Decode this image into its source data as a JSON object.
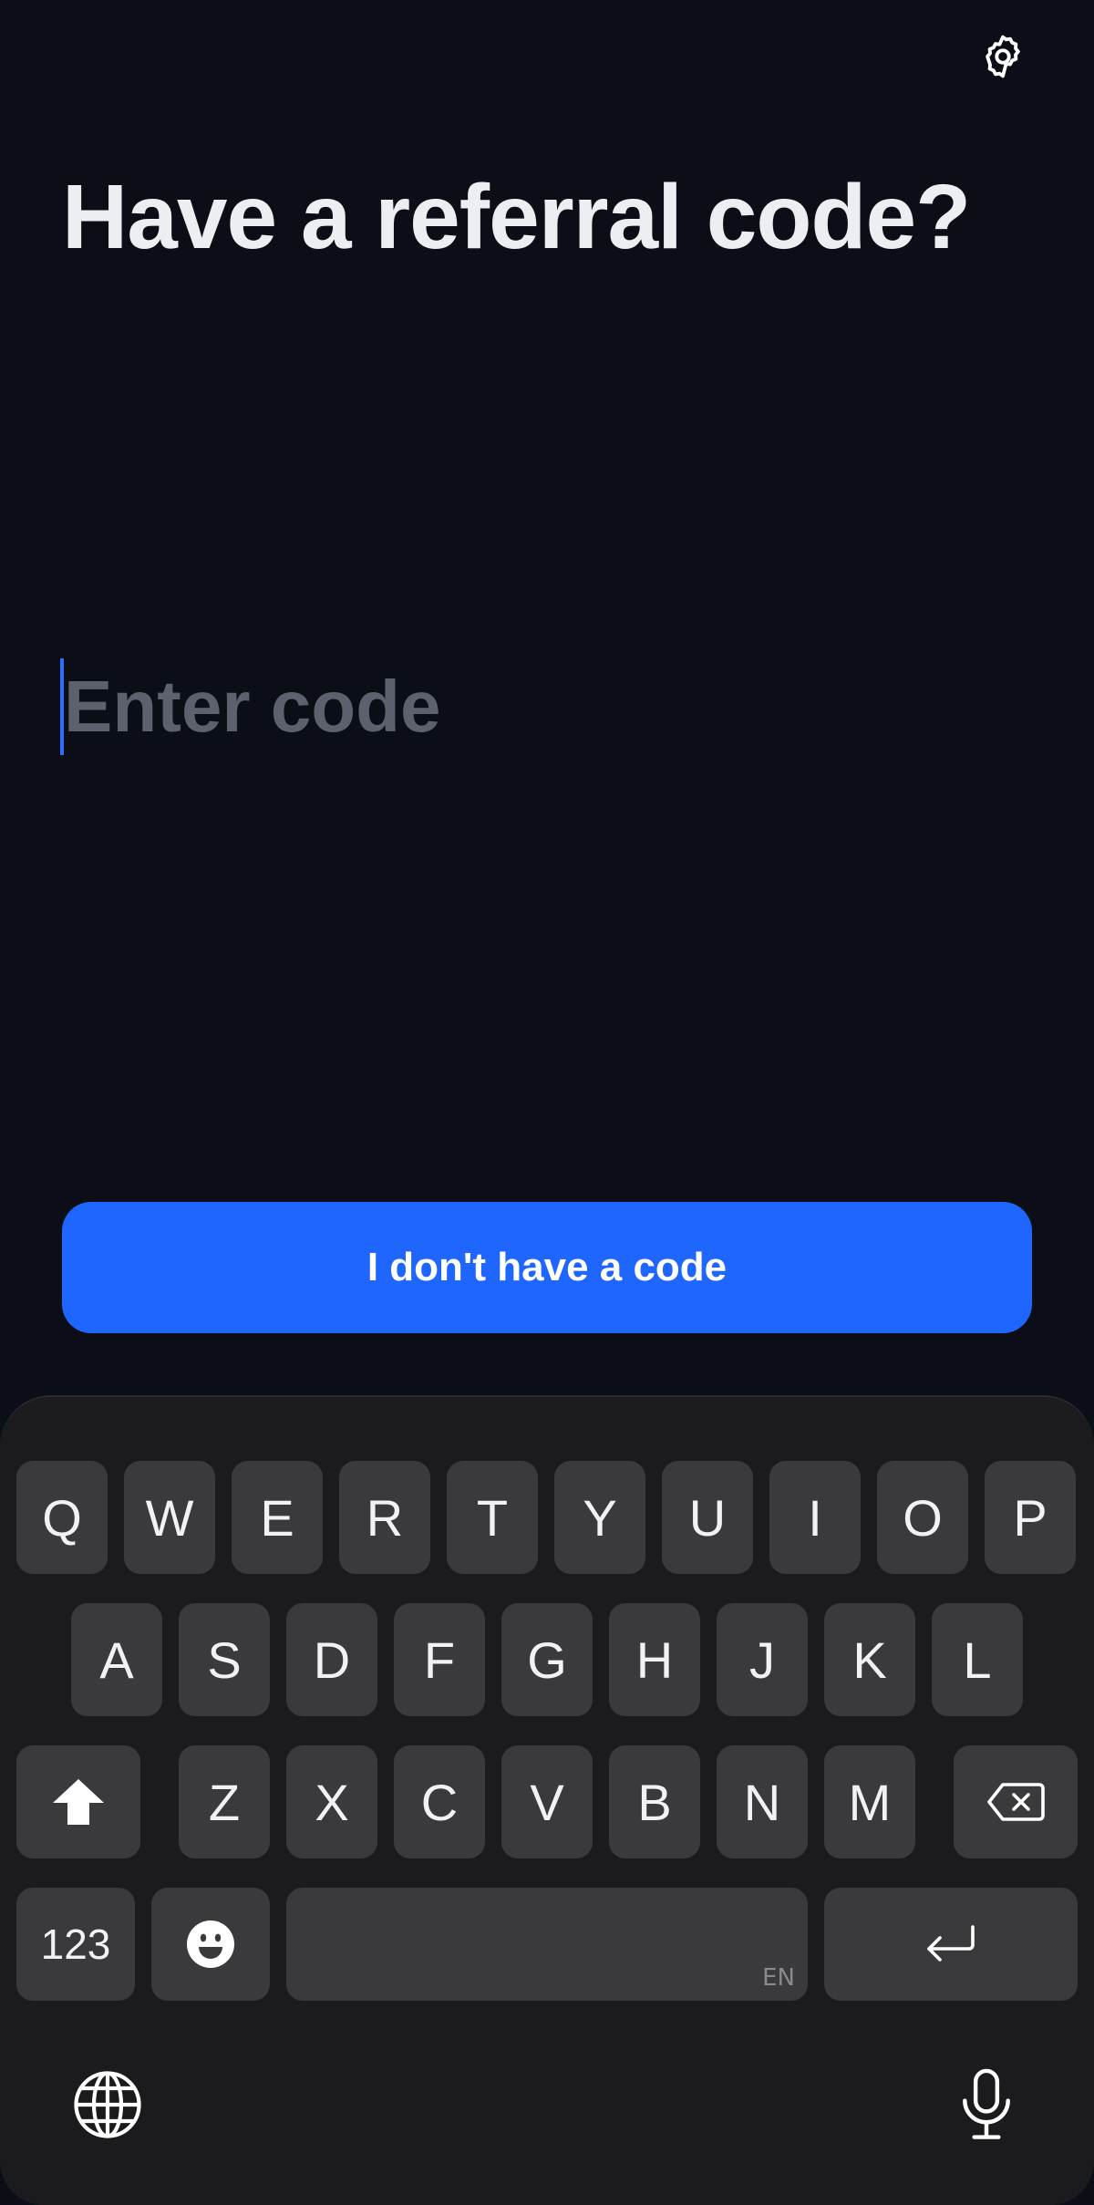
{
  "title": "Have a referral code?",
  "code_input": {
    "placeholder": "Enter code",
    "value": ""
  },
  "no_code_button": "I don't have a code",
  "colors": {
    "background": "#0b0e16",
    "accent": "#1f66ff",
    "keyboard_bg": "#1b1b1d",
    "key_bg": "#3a3a3c"
  },
  "keyboard": {
    "row1": [
      "Q",
      "W",
      "E",
      "R",
      "T",
      "Y",
      "U",
      "I",
      "O",
      "P"
    ],
    "row2": [
      "A",
      "S",
      "D",
      "F",
      "G",
      "H",
      "J",
      "K",
      "L"
    ],
    "row3": [
      "Z",
      "X",
      "C",
      "V",
      "B",
      "N",
      "M"
    ],
    "numbers_key": "123",
    "space_language": "EN",
    "icons": {
      "shift": "shift-icon",
      "backspace": "backspace-icon",
      "emoji": "emoji-icon",
      "enter": "enter-icon",
      "globe": "globe-icon",
      "mic": "microphone-icon",
      "settings": "gear-icon"
    }
  }
}
